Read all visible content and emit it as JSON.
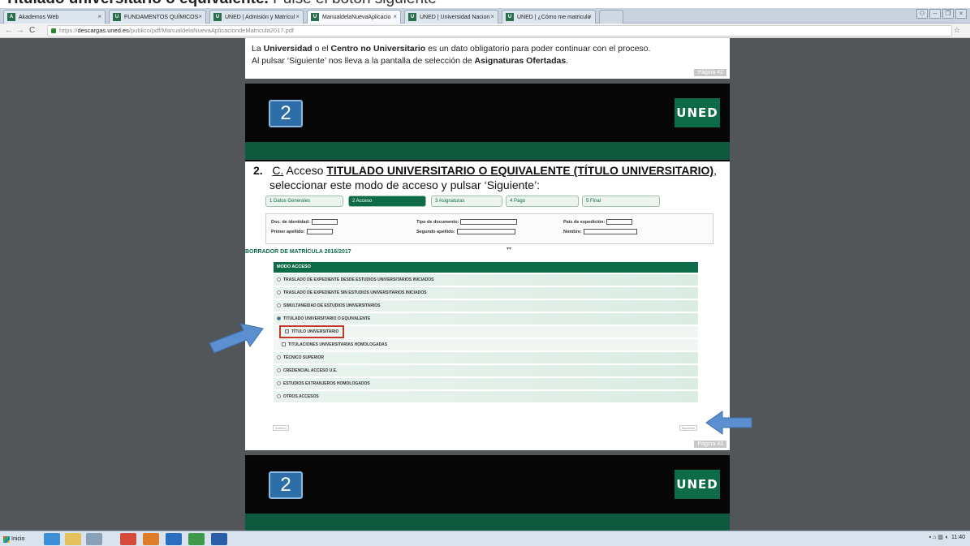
{
  "caption": {
    "bold": "Titulado universitario o equivalente.",
    "rest": " Pulse el botón siguiente"
  },
  "browser": {
    "tabs": [
      {
        "label": "Akademos Web"
      },
      {
        "label": "FUNDAMENTOS QUÍMICOS"
      },
      {
        "label": "UNED | Admisión y Matrícul"
      },
      {
        "label": "ManualdelaNuevaAplicacio"
      },
      {
        "label": "UNED | Universidad Nacion"
      },
      {
        "label": "UNED | ¿Cómo me matriculo"
      }
    ],
    "url_scheme": "https://",
    "url_host": "descargas.uned.es",
    "url_path": "/publico/pdf/ManualdelaNuevaAplicaciondeMatricula2017.pdf"
  },
  "page1": {
    "line1_a": "La ",
    "line1_b": "Universidad",
    "line1_c": " o el ",
    "line1_d": "Centro no Universitario",
    "line1_e": " es un dato obligatorio para poder continuar con el proceso.",
    "line2_a": "Al pulsar ‘Siguiente’ nos lleva a la pantalla de selección de ",
    "line2_b": "Asignaturas Ofertadas",
    "line2_c": ".",
    "page_label": "Página 42"
  },
  "page2": {
    "slide_number": "2",
    "brand": "UNED",
    "heading_num": "2.",
    "heading_c": "C.",
    "heading_a": " Acceso ",
    "heading_b": "TITULADO UNIVERSITARIO O EQUIVALENTE (TÍTULO UNIVERSITARIO)",
    "heading_c2": ",",
    "heading_line2": "seleccionar este modo de acceso y pulsar ‘Siguiente’:",
    "steps": [
      "1  Datos Generales",
      "2  Acceso",
      "3  Asignaturas",
      "4  Pago",
      "5  Final"
    ],
    "fields": {
      "doc_id": "Doc. de identidad:",
      "apellido1": "Primer apellido:",
      "tipo_doc": "Tipo de documento:",
      "apellido2": "Segundo apellido:",
      "pais": "País de expedición:",
      "nombre": "Nombre:"
    },
    "borrador": "BORRADOR DE MATRÍCULA 2016/2017",
    "modo_acceso": "MODO ACCESO",
    "options": [
      "TRASLADO DE EXPEDIENTE DESDE ESTUDIOS UNIVERSITARIOS INICIADOS",
      "TRASLADO DE EXPEDIENTE SIN ESTUDIOS UNIVERSITARIOS INICIADOS",
      "SIMULTANEIDAD DE ESTUDIOS UNIVERSITARIOS",
      "TITULADO UNIVERSITARIO O EQUIVALENTE",
      "TÍTULO UNIVERSITARIO",
      "TITULACIONES UNIVERSITARIAS HOMOLOGADAS",
      "TÉCNICO SUPERIOR",
      "CREDENCIAL ACCESO U.E.",
      "ESTUDIOS EXTRANJEROS HOMOLOGADOS",
      "OTROS ACCESOS"
    ],
    "btn_anterior": "Anterior",
    "btn_siguiente": "Siguiente",
    "page_label": "Página 43"
  },
  "page3": {
    "slide_number": "2",
    "brand": "UNED"
  },
  "taskbar": {
    "start": "Inicio",
    "time": "11:40"
  },
  "colors": {
    "uned_green": "#0e6b48",
    "slide_blue": "#2d6ea8",
    "highlight_red": "#c0392b",
    "arrow_blue": "#5b8fcf"
  }
}
